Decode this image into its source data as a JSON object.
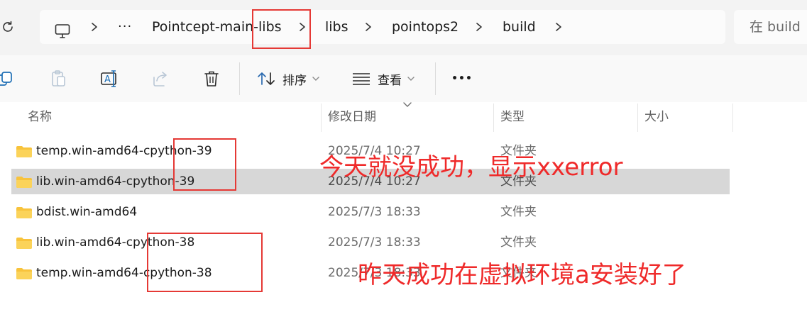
{
  "breadcrumb": {
    "ellipsis": "···",
    "items": [
      "Pointcept-main-libs",
      "libs",
      "pointops2",
      "build"
    ]
  },
  "search": {
    "placeholder": "在 build"
  },
  "toolbar": {
    "sort_label": "排序",
    "view_label": "查看",
    "more_label": "•••"
  },
  "columns": {
    "name": "名称",
    "modified": "修改日期",
    "type": "类型",
    "size": "大小"
  },
  "files": [
    {
      "name": "temp.win-amd64-cpython-39",
      "modified": "2025/7/4 10:27",
      "type": "文件夹"
    },
    {
      "name": "lib.win-amd64-cpython-39",
      "modified": "2025/7/4 10:27",
      "type": "文件夹"
    },
    {
      "name": "bdist.win-amd64",
      "modified": "2025/7/3 18:33",
      "type": "文件夹"
    },
    {
      "name": "lib.win-amd64-cpython-38",
      "modified": "2025/7/3 18:33",
      "type": "文件夹"
    },
    {
      "name": "temp.win-amd64-cpython-38",
      "modified": "2025/7/3 18:33",
      "type": "文件夹"
    }
  ],
  "annotations": {
    "top": "今天就没成功，显示xxerror",
    "bottom": "昨天成功在虚拟环境a安装好了"
  },
  "colors": {
    "annotation": "#ef2a2a",
    "folder": "#f8c33c",
    "selection": "#d7d7d7"
  }
}
